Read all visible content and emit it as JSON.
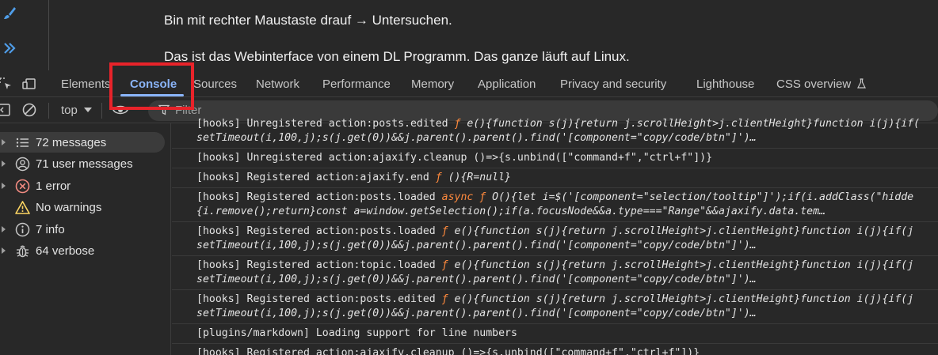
{
  "page": {
    "line1": "Bin mit rechter Maustaste drauf → Untersuchen.",
    "line2": "Das ist das Webinterface von einem DL Programm. Das ganze läuft auf Linux."
  },
  "tabs": [
    {
      "label": "Elements"
    },
    {
      "label": "Console"
    },
    {
      "label": "Sources"
    },
    {
      "label": "Network"
    },
    {
      "label": "Performance"
    },
    {
      "label": "Memory"
    },
    {
      "label": "Application"
    },
    {
      "label": "Privacy and security"
    },
    {
      "label": "Lighthouse"
    },
    {
      "label": "CSS overview"
    }
  ],
  "active_tab": "Console",
  "toolbar": {
    "context": "top",
    "filter_placeholder": "Filter"
  },
  "sidebar": {
    "items": [
      {
        "label": "72 messages",
        "icon": "list-icon"
      },
      {
        "label": "71 user messages",
        "icon": "user-icon"
      },
      {
        "label": "1 error",
        "icon": "error-icon"
      },
      {
        "label": "No warnings",
        "icon": "warning-icon"
      },
      {
        "label": "7 info",
        "icon": "info-icon"
      },
      {
        "label": "64 verbose",
        "icon": "bug-icon"
      }
    ]
  },
  "messages": [
    {
      "l1": "[hooks] Unregistered action:posts.edited ƒ e(){function s(j){return j.scrollHeight>j.clientHeight}function i(j){if(",
      "l2": "setTimeout(i,100,j);s(j.get(0))&&j.parent().parent().find('[component=\"copy/code/btn\"]')…"
    },
    {
      "l1": "[hooks] Unregistered action:ajaxify.cleanup ()=>{s.unbind([\"command+f\",\"ctrl+f\"])}"
    },
    {
      "l1": "[hooks] Registered action:ajaxify.end ƒ (){R=null}"
    },
    {
      "l1": "[hooks] Registered action:posts.loaded async ƒ O(){let i=$('[component=\"selection/tooltip\"]');if(i.addClass(\"hidde",
      "l2": "{i.remove();return}const a=window.getSelection();if(a.focusNode&&a.type===\"Range\"&&ajaxify.data.tem…"
    },
    {
      "l1": "[hooks] Registered action:posts.loaded ƒ e(){function s(j){return j.scrollHeight>j.clientHeight}function i(j){if(j",
      "l2": "setTimeout(i,100,j);s(j.get(0))&&j.parent().parent().find('[component=\"copy/code/btn\"]')…"
    },
    {
      "l1": "[hooks] Registered action:topic.loaded ƒ e(){function s(j){return j.scrollHeight>j.clientHeight}function i(j){if(j",
      "l2": "setTimeout(i,100,j);s(j.get(0))&&j.parent().parent().find('[component=\"copy/code/btn\"]')…"
    },
    {
      "l1": "[hooks] Registered action:posts.edited ƒ e(){function s(j){return j.scrollHeight>j.clientHeight}function i(j){if(j",
      "l2": "setTimeout(i,100,j);s(j.get(0))&&j.parent().parent().find('[component=\"copy/code/btn\"]')…"
    },
    {
      "l1": "[plugins/markdown] Loading support for line numbers"
    },
    {
      "l1": "[hooks] Registered action:ajaxify.cleanup ()=>{s.unbind([\"command+f\",\"ctrl+f\"])}"
    }
  ],
  "colors": {
    "accent": "#8ab4f8",
    "highlight": "#e8232a",
    "error": "#f28b82",
    "warning": "#fdd663",
    "keyword": "#ff8a3d"
  }
}
